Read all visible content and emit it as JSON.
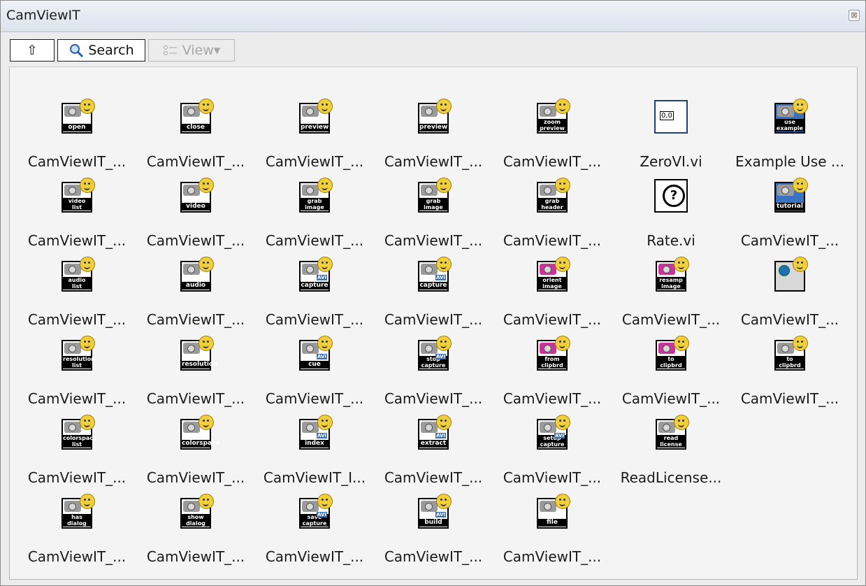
{
  "window": {
    "title": "CamViewIT"
  },
  "toolbar": {
    "up_label": "⇧",
    "search_label": "Search",
    "view_label": "View▾"
  },
  "items": [
    {
      "label": "CamViewIT_...",
      "icon": "open-vi-icon",
      "word": "open",
      "kind": "cam"
    },
    {
      "label": "CamViewIT_...",
      "icon": "close-vi-icon",
      "word": "close",
      "kind": "cam"
    },
    {
      "label": "CamViewIT_...",
      "icon": "preview-vi-icon",
      "word": "preview",
      "kind": "cam"
    },
    {
      "label": "CamViewIT_...",
      "icon": "preview-dialog-vi-icon",
      "word": "preview",
      "kind": "cam"
    },
    {
      "label": "CamViewIT_...",
      "icon": "zoom-preview-vi-icon",
      "word": "zoom preview",
      "kind": "cam"
    },
    {
      "label": "ZeroVI.vi",
      "icon": "zero-vi-icon",
      "word": "0,0",
      "kind": "zero"
    },
    {
      "label": "Example Use ...",
      "icon": "use-example-vi-icon",
      "word": "use example",
      "kind": "blue"
    },
    {
      "label": "CamViewIT_...",
      "icon": "video-list-vi-icon",
      "word": "video list",
      "kind": "cam"
    },
    {
      "label": "CamViewIT_...",
      "icon": "video-vi-icon",
      "word": "video",
      "kind": "cam"
    },
    {
      "label": "CamViewIT_...",
      "icon": "grab-image-vi-icon",
      "word": "grab image",
      "kind": "cam"
    },
    {
      "label": "CamViewIT_...",
      "icon": "grab-image-2-vi-icon",
      "word": "grab image",
      "kind": "cam"
    },
    {
      "label": "CamViewIT_...",
      "icon": "grab-header-vi-icon",
      "word": "grab header",
      "kind": "cam"
    },
    {
      "label": "Rate.vi",
      "icon": "stopwatch-icon",
      "word": "?",
      "kind": "rate"
    },
    {
      "label": "CamViewIT_...",
      "icon": "tutorial-vi-icon",
      "word": "tutorial",
      "kind": "blue"
    },
    {
      "label": "CamViewIT_...",
      "icon": "audio-list-vi-icon",
      "word": "audio list",
      "kind": "cam"
    },
    {
      "label": "CamViewIT_...",
      "icon": "audio-vi-icon",
      "word": "audio",
      "kind": "cam"
    },
    {
      "label": "CamViewIT_...",
      "icon": "capture-avi-vi-icon",
      "word": "capture",
      "kind": "cam",
      "avi": "AVI"
    },
    {
      "label": "CamViewIT_...",
      "icon": "capture-avi-dialog-vi-icon",
      "word": "capture",
      "kind": "cam",
      "avi": "AVI"
    },
    {
      "label": "CamViewIT_...",
      "icon": "orient-image-vi-icon",
      "word": "orient image",
      "kind": "pink"
    },
    {
      "label": "CamViewIT_...",
      "icon": "resamp-image-vi-icon",
      "word": "resamp image",
      "kind": "pink"
    },
    {
      "label": "CamViewIT_...",
      "icon": "globe-vi-icon",
      "word": "",
      "kind": "globe"
    },
    {
      "label": "CamViewIT_...",
      "icon": "resolution-list-vi-icon",
      "word": "resolution list",
      "kind": "cam"
    },
    {
      "label": "CamViewIT_...",
      "icon": "resolution-vi-icon",
      "word": "resolution",
      "kind": "cam"
    },
    {
      "label": "CamViewIT_...",
      "icon": "cue-avi-vi-icon",
      "word": "cue",
      "kind": "cam",
      "avi": "AVI"
    },
    {
      "label": "CamViewIT_...",
      "icon": "stop-capture-vi-icon",
      "word": "stop capture",
      "kind": "cam",
      "avi": "AVI"
    },
    {
      "label": "CamViewIT_...",
      "icon": "from-clipbrd-vi-icon",
      "word": "from clipbrd",
      "kind": "pink"
    },
    {
      "label": "CamViewIT_...",
      "icon": "to-clipbrd-vi-icon",
      "word": "to clipbrd",
      "kind": "pink"
    },
    {
      "label": "CamViewIT_...",
      "icon": "to-clipbrd-2-vi-icon",
      "word": "to clipbrd",
      "kind": "cam"
    },
    {
      "label": "CamViewIT_...",
      "icon": "colorspace-list-vi-icon",
      "word": "colorspace list",
      "kind": "cam"
    },
    {
      "label": "CamViewIT_...",
      "icon": "colorspace-vi-icon",
      "word": "colorspace",
      "kind": "cam"
    },
    {
      "label": "CamViewIT_I...",
      "icon": "index-avi-vi-icon",
      "word": "index",
      "kind": "cam",
      "avi": "AVI"
    },
    {
      "label": "CamViewIT_...",
      "icon": "extract-avi-vi-icon",
      "word": "extract",
      "kind": "cam",
      "avi": "AVI"
    },
    {
      "label": "CamViewIT_...",
      "icon": "setup-capture-vi-icon",
      "word": "setup capture",
      "kind": "cam",
      "avi": "AVI"
    },
    {
      "label": "ReadLicense...",
      "icon": "read-license-vi-icon",
      "word": "read license",
      "kind": "cam"
    },
    {
      "label": "",
      "icon": "",
      "word": "",
      "kind": "empty"
    },
    {
      "label": "CamViewIT_...",
      "icon": "has-dialog-vi-icon",
      "word": "has dialog",
      "kind": "cam"
    },
    {
      "label": "CamViewIT_...",
      "icon": "show-dialog-vi-icon",
      "word": "show dialog",
      "kind": "cam"
    },
    {
      "label": "CamViewIT_...",
      "icon": "save-capture-vi-icon",
      "word": "save capture",
      "kind": "cam",
      "avi": "AVI"
    },
    {
      "label": "CamViewIT_...",
      "icon": "build-avi-vi-icon",
      "word": "build",
      "kind": "cam",
      "avi": "AVI"
    },
    {
      "label": "CamViewIT_...",
      "icon": "png-file-vi-icon",
      "word": "file",
      "kind": "cam"
    }
  ]
}
